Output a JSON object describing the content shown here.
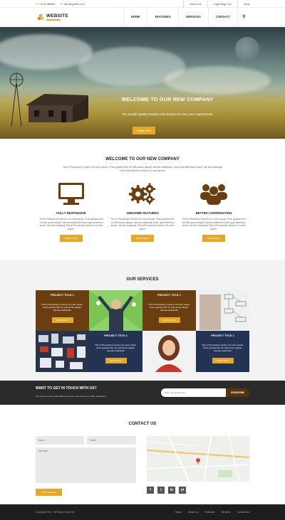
{
  "topbar": {
    "phone": "01-4246868",
    "email": "abc@gmail.com",
    "links": [
      "About Us",
      "Login/Sign Up",
      "Help"
    ]
  },
  "header": {
    "logo_text": "WEBSITE",
    "nav": [
      "HOME",
      "FEATURES",
      "SERVICES",
      "CONTACT"
    ],
    "search_icon": "search-icon"
  },
  "hero": {
    "title": "WELCOME TO OUR NEW COMPANY",
    "subtitle": "We provide Quality Designs and Services to meet your requirements",
    "button": "Explore More"
  },
  "welcome": {
    "title": "WELCOME TO OUR NEW COMPANY",
    "text": "This is Photoshop's version of Lorem Ipsum. Proin gravida nibh vel velit auctor aliquet. Aenean sollicitudin, lorem quis bibendum auctor, nisi elit consequat This is Photoshop's version of Lorem Ipsum.",
    "features": [
      {
        "icon": "monitor-icon",
        "title": "FULLY RESPONSIVE",
        "text": "This is Photoshop's version of Lorem Ipsum. Proin gravida nibh vel velit auctor aliquet. Aenean sollicitudin,lorem quis bibendum auctor, nisi elit consequat This is Photoshop's version of Lorem Ipsum.",
        "button": "Explore More"
      },
      {
        "icon": "gears-icon",
        "title": "AWESOME FEATURES",
        "text": "This is Photoshop's version of Lorem Ipsum. Proin gravida nibh vel velit auctor aliquet. Aenean sollicitudin,lorem quis bibendum auctor, nisi elit consequat This is Photoshop's version of Lorem Ipsum.",
        "button": "Explore More"
      },
      {
        "icon": "team-icon",
        "title": "BETTER COORDINATION",
        "text": "This is Photoshop's version of Lorem Ipsum. Proin gravida nibh vel velit auctor aliquet. Aenean sollicitudin,lorem quis bibendum auctor, nisi elit consequat This is Photoshop's version of Lorem Ipsum.",
        "button": "Explore More"
      }
    ]
  },
  "services": {
    "title": "OUR SERVICES",
    "tiles": [
      {
        "title": "PROJECT TITLE 1",
        "text": "This is Photoshop's version of Lorem Ipsum. Proin gravida nibh vel velit auctor aliquet. Aenean sollicitudin",
        "button": "Explore More"
      },
      {
        "title": "PROJECT TITLE 1",
        "text": "This is Photoshop's version of Lorem Ipsum. Proin gravida nibh vel velit auctor aliquet. Aenean sollicitudin",
        "button": "Explore More"
      },
      {
        "title": "PROJECT TITLE 1",
        "text": "This is Photoshop's version of Lorem Ipsum. Proin gravida nibh vel velit auctor aliquet. Aenean sollicitudin",
        "button": "Explore More"
      },
      {
        "title": "PROJECT TITLE 1",
        "text": "This is Photoshop's version of Lorem Ipsum. Proin gravida nibh vel velit auctor aliquet. Aenean sollicitudin",
        "button": "Explore More"
      }
    ]
  },
  "newsletter": {
    "title": "WANT TO GET IN TOUCH WITH US?",
    "subtitle": "Just send us your email address and you can receive our daily newsletters.",
    "placeholder": "Enter Your Email here...",
    "button": "SUBSCRIBE"
  },
  "contact": {
    "title": "CONTACT US",
    "name_placeholder": "Name*",
    "email_placeholder": "Email*",
    "message_placeholder": "Message",
    "button": "Send Feedback",
    "socials": [
      "f",
      "t",
      "in",
      "yt"
    ]
  },
  "footer": {
    "copyright": "Copyright©2017. All Rights Reserved.",
    "nav": [
      "Home",
      "About Us",
      "Features",
      "Services",
      "Contact Us"
    ]
  },
  "colors": {
    "accent": "#e5a92a",
    "brown": "#6a3e10",
    "navy": "#233354",
    "dark": "#2b2b2b"
  }
}
